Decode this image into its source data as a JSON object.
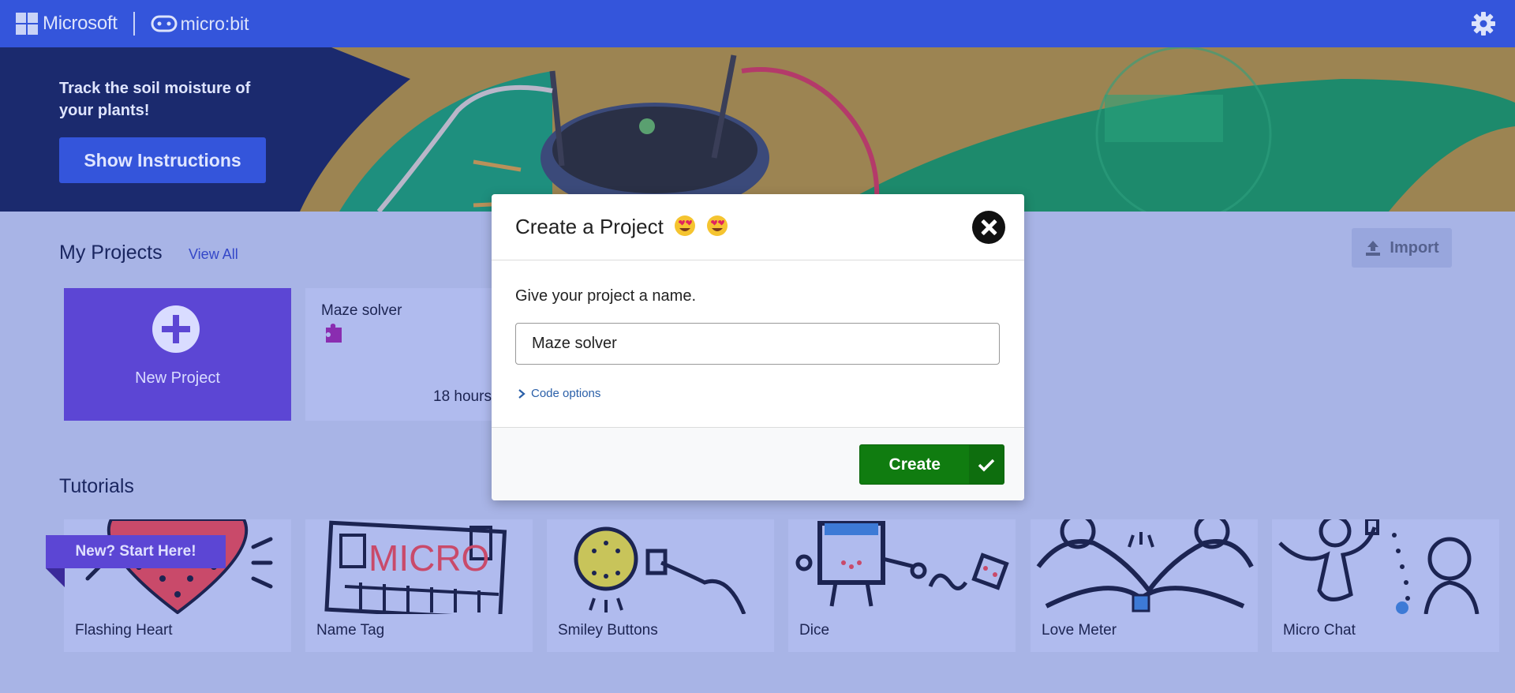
{
  "header": {
    "brand": "Microsoft",
    "product": "micro:bit",
    "settings_icon": "gear-icon"
  },
  "hero": {
    "text": "Track the soil moisture of your plants!",
    "button_label": "Show Instructions"
  },
  "my_projects": {
    "title": "My Projects",
    "view_all": "View All",
    "import_label": "Import",
    "new_project_label": "New Project",
    "projects": [
      {
        "name": "Maze solver",
        "time": "18 hours"
      }
    ]
  },
  "tutorials": {
    "title": "Tutorials",
    "ribbon": "New? Start Here!",
    "items": [
      {
        "label": "Flashing Heart"
      },
      {
        "label": "Name Tag"
      },
      {
        "label": "Smiley Buttons"
      },
      {
        "label": "Dice"
      },
      {
        "label": "Love Meter"
      },
      {
        "label": "Micro Chat"
      }
    ]
  },
  "modal": {
    "title": "Create a Project",
    "title_emoji": "smiling-face-with-heart-eyes",
    "prompt": "Give your project a name.",
    "input_value": "Maze solver",
    "code_options": "Code options",
    "create_label": "Create"
  },
  "colors": {
    "header_bg": "#3455db",
    "accent_purple": "#5c46d4",
    "create_green": "#107c10",
    "page_overlay": "#a8b4e6"
  }
}
